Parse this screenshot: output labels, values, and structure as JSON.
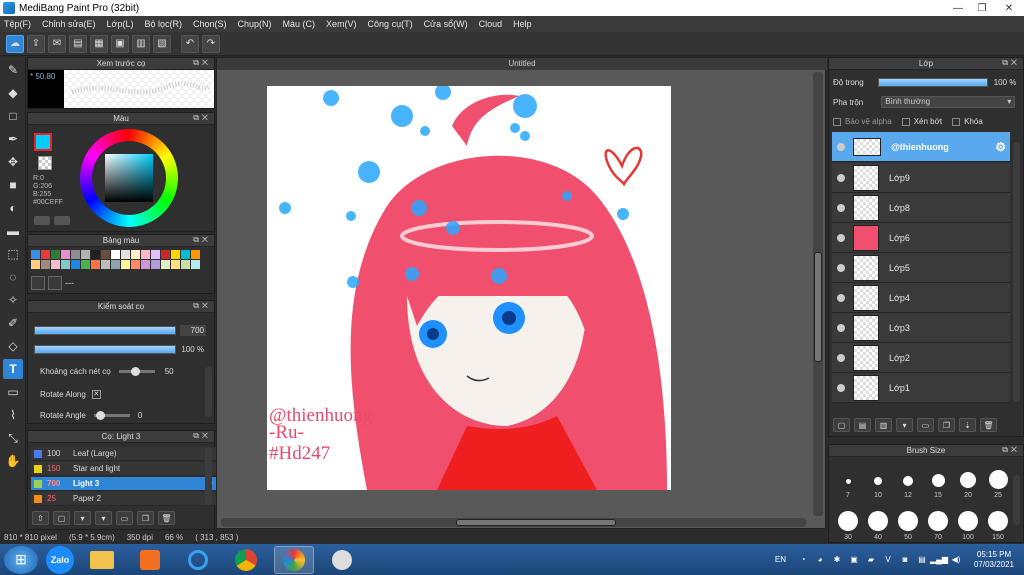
{
  "window": {
    "title": "MediBang Paint Pro (32bit)",
    "minimize": "—",
    "maximize": "❐",
    "close": "✕"
  },
  "menu": [
    "Tệp(F)",
    "Chỉnh sửa(E)",
    "Lớp(L)",
    "Bộ lọc(R)",
    "Chọn(S)",
    "Chụp(N)",
    "Màu (C)",
    "Xem(V)",
    "Công cụ(T)",
    "Cửa sổ(W)",
    "Cloud",
    "Help"
  ],
  "toolbar": {
    "undo_icon": "↶",
    "redo_icon": "↷"
  },
  "brush_preview": {
    "title": "Xem trước cọ",
    "size": "50.80"
  },
  "color_panel": {
    "title": "Màu",
    "r": "R:0",
    "g": "G:206",
    "b": "B:255",
    "hex": "#00CEFF",
    "fg_color": "#00cfff"
  },
  "palette": {
    "title": "Bảng màu",
    "colors": [
      "#3b8ee8",
      "#e43b3b",
      "#2e7d32",
      "#e98cd0",
      "#8e8e8e",
      "#b3b3b3",
      "#212121",
      "#6e4c3a",
      "#ffffff",
      "#e2e2e2",
      "#ffeec5",
      "#ffb7c3",
      "#e0c0ff",
      "#c62828",
      "#ffd600",
      "#00bcd4",
      "#ff9800",
      "#ffcc80",
      "#a1887f",
      "#f8bbd0",
      "#80cbc4",
      "#1e88e5",
      "#4caf50",
      "#ff7043",
      "#bdbdbd",
      "#90a4ae",
      "#fff59d",
      "#ff8a65",
      "#ce93d8",
      "#b39ddb",
      "#dcedc8",
      "#ffe082",
      "#c5e1a5",
      "#b2ebf2"
    ],
    "label": "---"
  },
  "brush_control": {
    "title": "Kiểm soát cọ",
    "size": "700",
    "opacity": "100 %",
    "size_fraction": 1.0,
    "opacity_fraction": 1.0,
    "spacing_label": "Khoảng cách nét cọ",
    "spacing_value": "50",
    "rotate_along_label": "Rotate Along",
    "rotate_along_check": "✕",
    "rotate_angle_label": "Rotate Angle",
    "rotate_angle_value": "0"
  },
  "brush_list": {
    "title": "Cọ: Light 3",
    "items": [
      {
        "size": "100",
        "name": "Leaf (Large)",
        "color": "#4a7cf0"
      },
      {
        "size": "150",
        "name": "Star and light",
        "color": "#e8d21a"
      },
      {
        "size": "700",
        "name": "Light 3",
        "color": "#9ccf58",
        "selected": true
      },
      {
        "size": "25",
        "name": "Paper 2",
        "color": "#f28c1a"
      }
    ]
  },
  "document": {
    "tab": "Untitled"
  },
  "canvas": {
    "text_line1": "@thienhuong",
    "text_line2": "-Ru-",
    "text_line3": "#Hd247"
  },
  "status": {
    "dimensions": "810 * 810 pixel",
    "physical": "(5.9 * 5.9cm)",
    "dpi": "350 dpi",
    "zoom": "66 %",
    "coords": "( 313 , 853 )"
  },
  "layer_panel": {
    "title": "Lớp",
    "opacity_label": "Độ trong",
    "opacity_value": "100 %",
    "opacity_fraction": 1.0,
    "blend_label": "Pha trộn",
    "blend_value": "Bình thường",
    "protect_alpha": "Bảo vệ alpha",
    "clipping": "Xén bớt",
    "lock": "Khóa",
    "layers": [
      {
        "name": "@thienhuong",
        "selected": true
      },
      {
        "name": "Lớp9"
      },
      {
        "name": "Lớp8"
      },
      {
        "name": "Lớp6"
      },
      {
        "name": "Lớp5"
      },
      {
        "name": "Lớp4"
      },
      {
        "name": "Lớp3"
      },
      {
        "name": "Lớp2"
      },
      {
        "name": "Lớp1"
      }
    ]
  },
  "brush_size": {
    "title": "Brush Size",
    "sizes": [
      "7",
      "10",
      "12",
      "15",
      "20",
      "25",
      "30",
      "40",
      "50",
      "70",
      "100",
      "150"
    ]
  },
  "taskbar": {
    "apps": [
      "Zalo",
      "Explorer",
      "Media",
      "IE",
      "Chrome",
      "MediBang",
      "App"
    ],
    "lang": "EN",
    "time": "05:15 PM",
    "date": "07/03/2021"
  }
}
